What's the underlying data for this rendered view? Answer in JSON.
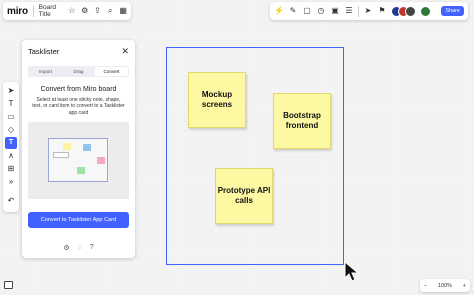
{
  "topbar": {
    "logo": "miro",
    "board_title": "Board Title",
    "icons": [
      "star-icon",
      "gear-icon",
      "upload-icon",
      "search-icon",
      "grid-icon"
    ]
  },
  "collab": {
    "icons": [
      "bolt-icon",
      "pen-icon",
      "comment-icon",
      "timer-icon",
      "present-icon",
      "notes-icon"
    ],
    "share_label": "Share",
    "avatar_colors": [
      "#1f3b8f",
      "#c0392b",
      "#2c7a3a",
      "#444444"
    ]
  },
  "left_toolbar": {
    "tools": [
      "cursor-icon",
      "text-icon",
      "sticky-icon",
      "shapes-icon",
      "app-icon",
      "pen-icon",
      "frame-icon",
      "more-icon",
      "undo-icon"
    ]
  },
  "panel": {
    "title": "Tasklister",
    "tabs": [
      {
        "label": "Import",
        "active": false
      },
      {
        "label": "Drag",
        "active": false
      },
      {
        "label": "Convert",
        "active": true
      }
    ],
    "heading": "Convert from Miro board",
    "description": "Select at least one sticky note, shape, text, or card item to convert to a Tasklister app card",
    "convert_button": "Convert to Tasklister App Card"
  },
  "canvas": {
    "stickies": [
      {
        "text": "Mockup screens"
      },
      {
        "text": "Bootstrap frontend"
      },
      {
        "text": "Prototype API calls"
      }
    ],
    "frame_color": "#4262ff",
    "sticky_color": "#fdf9a3"
  },
  "bottombar": {
    "zoom_out": "−",
    "zoom_level": "100%",
    "zoom_in": "+"
  }
}
